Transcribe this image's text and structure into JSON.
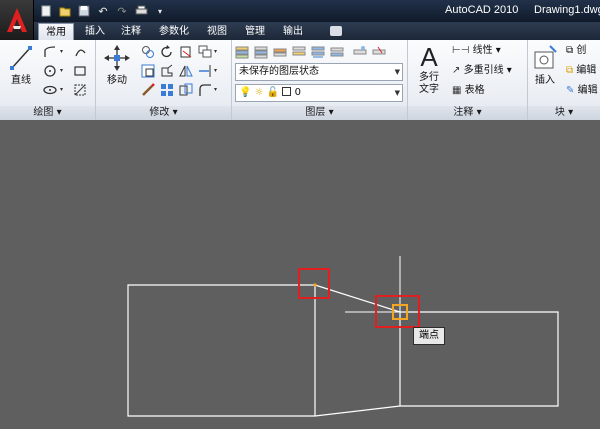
{
  "title_bar": {
    "app_name": "AutoCAD 2010",
    "document_name": "Drawing1.dwg",
    "quick_access": [
      "new-icon",
      "open-icon",
      "save-icon",
      "undo-icon",
      "redo-icon",
      "plot-icon",
      "dropdown-icon"
    ]
  },
  "tabs": [
    {
      "label": "常用",
      "active": true
    },
    {
      "label": "插入",
      "active": false
    },
    {
      "label": "注释",
      "active": false
    },
    {
      "label": "参数化",
      "active": false
    },
    {
      "label": "视图",
      "active": false
    },
    {
      "label": "管理",
      "active": false
    },
    {
      "label": "输出",
      "active": false
    }
  ],
  "ribbon": {
    "draw": {
      "title": "绘图",
      "line_label": "直线"
    },
    "modify": {
      "title": "修改",
      "move_label": "移动"
    },
    "layers": {
      "title": "图层",
      "layer_state_value": "未保存的图层状态",
      "current_layer_value": "0"
    },
    "annotation": {
      "title": "注释",
      "mtext_label": "多行文字",
      "mtext_line1": "多行",
      "mtext_line2": "文字",
      "linear_label": "线性",
      "mleader_label": "多重引线",
      "table_label": "表格"
    },
    "block": {
      "title": "块",
      "insert_label": "插入",
      "create_label": "创",
      "edit_label": "编辑",
      "edit_attr_label": "编辑"
    }
  },
  "canvas": {
    "background": "#5f5f5f",
    "line_color": "#ffffff",
    "highlight_color": "#e02020",
    "snap_color": "#f5a623",
    "tooltip_text": "端点"
  }
}
